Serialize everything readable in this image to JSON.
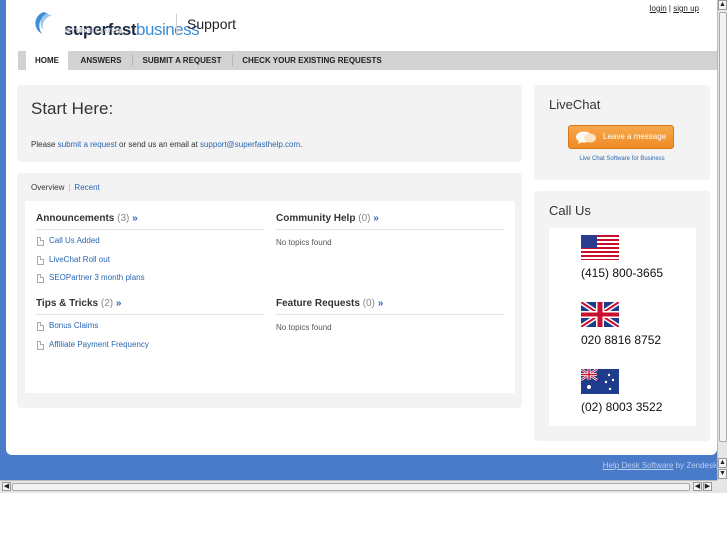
{
  "header": {
    "logo_bold": "superfast",
    "logo_light": "business",
    "title": "Support",
    "login": "login",
    "auth_sep": "|",
    "signup": "sign up"
  },
  "nav": [
    "HOME",
    "ANSWERS",
    "SUBMIT A REQUEST",
    "CHECK YOUR EXISTING REQUESTS"
  ],
  "start": {
    "title": "Start Here:",
    "text_prefix": "Please ",
    "submit_link": "submit a request",
    "text_mid": " or send us an email at ",
    "email": "support@superfasthelp.com",
    "text_suffix": "."
  },
  "overview": {
    "tab_overview": "Overview",
    "tab_sep": "|",
    "tab_recent": "Recent",
    "sections": [
      {
        "title": "Announcements",
        "count": "(3)",
        "more": "»",
        "items": [
          "Call Us Added",
          "LiveChat Roll out",
          "SEOPartner 3 month plans"
        ],
        "empty": ""
      },
      {
        "title": "Community Help",
        "count": "(0)",
        "more": "»",
        "items": [],
        "empty": "No topics found"
      },
      {
        "title": "Tips & Tricks",
        "count": "(2)",
        "more": "»",
        "items": [
          "Bonus Claims",
          "Affiliate Payment Frequency"
        ],
        "empty": ""
      },
      {
        "title": "Feature Requests",
        "count": "(0)",
        "more": "»",
        "items": [],
        "empty": "No topics found"
      }
    ]
  },
  "livechat": {
    "title": "LiveChat",
    "button_label": "Leave a message",
    "caption": "Live Chat Software for Business"
  },
  "callus": {
    "title": "Call Us",
    "numbers": [
      {
        "flag": "us-flag-icon",
        "phone": "(415) 800-3665"
      },
      {
        "flag": "uk-flag-icon",
        "phone": "020 8816 8752"
      },
      {
        "flag": "au-flag-icon",
        "phone": "(02) 8003 3522"
      }
    ]
  },
  "footer": {
    "link": "Help Desk Software",
    "suffix": " by Zendesk"
  },
  "colors": {
    "accent_blue": "#2a67b0",
    "page_bg_blue": "#4a7bc9",
    "chat_orange": "#ef8a25"
  }
}
